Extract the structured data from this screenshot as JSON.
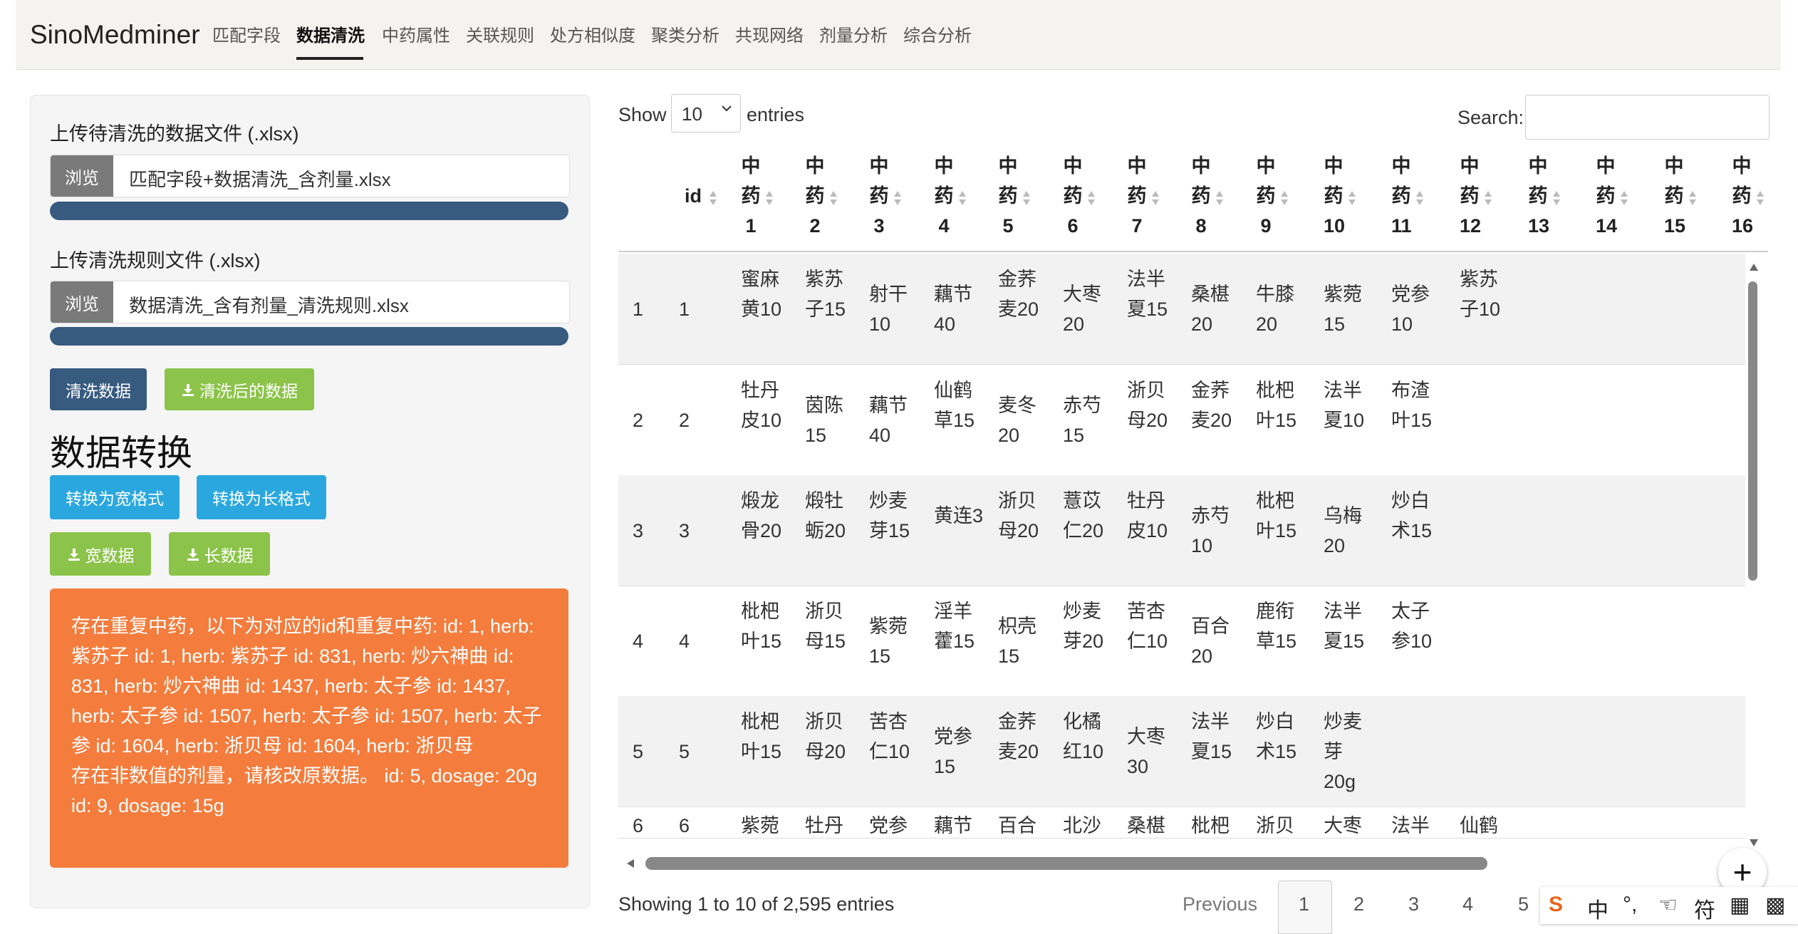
{
  "navbar": {
    "brand": "SinoMedminer",
    "items": [
      "匹配字段",
      "数据清洗",
      "中药属性",
      "关联规则",
      "处方相似度",
      "聚类分析",
      "共现网络",
      "剂量分析",
      "综合分析"
    ],
    "active": "数据清洗"
  },
  "sidebar": {
    "upload_data_label": "上传待清洗的数据文件 (.xlsx)",
    "upload_rules_label": "上传清洗规则文件 (.xlsx)",
    "browse_label": "浏览",
    "data_file_name": "匹配字段+数据清洗_含剂量.xlsx",
    "rules_file_name": "数据清洗_含有剂量_清洗规则.xlsx",
    "data_upload_progress": 1.0,
    "rules_upload_progress": 1.0,
    "clean_button": "清洗数据",
    "download_cleaned_button": "清洗后的数据",
    "transform_title": "数据转换",
    "to_wide_button": "转换为宽格式",
    "to_long_button": "转换为长格式",
    "download_wide_button": "宽数据",
    "download_long_button": "长数据",
    "alert_lines": [
      "存在重复中药，以下为对应的id和重复中药: id: 1, herb: 紫苏子 id: 1, herb: 紫苏子 id: 831, herb: 炒六神曲 id: 831, herb: 炒六神曲 id: 1437, herb: 太子参 id: 1437, herb: 太子参 id: 1507, herb: 太子参 id: 1507, herb: 太子参 id: 1604, herb: 浙贝母 id: 1604, herb: 浙贝母",
      "存在非数值的剂量，请核改原数据。 id: 5, dosage: 20g id: 9, dosage: 15g"
    ],
    "colors": {
      "primary": "#375a7f",
      "success": "#8cc34a",
      "info": "#2aa7df",
      "warning": "#f47c3c"
    }
  },
  "table": {
    "show_label": "Show",
    "page_length": "10",
    "entries_label": "entries",
    "search_label": "Search:",
    "search_value": "",
    "columns": [
      "id",
      "中药1",
      "中药2",
      "中药3",
      "中药4",
      "中药5",
      "中药6",
      "中药7",
      "中药8",
      "中药9",
      "中药10",
      "中药11",
      "中药12",
      "中药13",
      "中药14",
      "中药15",
      "中药16"
    ],
    "rows": [
      [
        "1",
        "1",
        "蜜麻黄10",
        "紫苏子15",
        "射干10",
        "藕节40",
        "金荞麦20",
        "大枣20",
        "法半夏15",
        "桑椹20",
        "牛膝20",
        "紫菀15",
        "党参10",
        "紫苏子10"
      ],
      [
        "2",
        "2",
        "牡丹皮10",
        "茵陈15",
        "藕节40",
        "仙鹤草15",
        "麦冬20",
        "赤芍15",
        "浙贝母20",
        "金荞麦20",
        "枇杷叶15",
        "法半夏10",
        "布渣叶15"
      ],
      [
        "3",
        "3",
        "煅龙骨20",
        "煅牡蛎20",
        "炒麦芽15",
        "黄连3",
        "浙贝母20",
        "薏苡仁20",
        "牡丹皮10",
        "赤芍10",
        "枇杷叶15",
        "乌梅20",
        "炒白术15"
      ],
      [
        "4",
        "4",
        "枇杷叶15",
        "浙贝母15",
        "紫菀15",
        "淫羊藿15",
        "枳壳15",
        "炒麦芽20",
        "苦杏仁10",
        "百合20",
        "鹿衔草15",
        "法半夏15",
        "太子参10"
      ],
      [
        "5",
        "5",
        "枇杷叶15",
        "浙贝母20",
        "苦杏仁10",
        "党参15",
        "金荞麦20",
        "化橘红10",
        "大枣30",
        "法半夏15",
        "炒白术15",
        "炒麦芽20g"
      ],
      [
        "6",
        "6",
        "紫菀",
        "牡丹皮",
        "党参",
        "藕节",
        "百合",
        "北沙参",
        "桑椹",
        "枇杷叶",
        "浙贝母",
        "大枣",
        "法半",
        "仙鹤"
      ]
    ],
    "info": "Showing 1 to 10 of 2,595 entries",
    "pagination": {
      "previous": "Previous",
      "pages": [
        "1",
        "2",
        "3",
        "4",
        "5"
      ],
      "current": "1"
    }
  },
  "fab_label": "+",
  "ime_toolbar": [
    "S",
    "中",
    "°,",
    "☜",
    "符",
    "▦",
    "▩"
  ]
}
